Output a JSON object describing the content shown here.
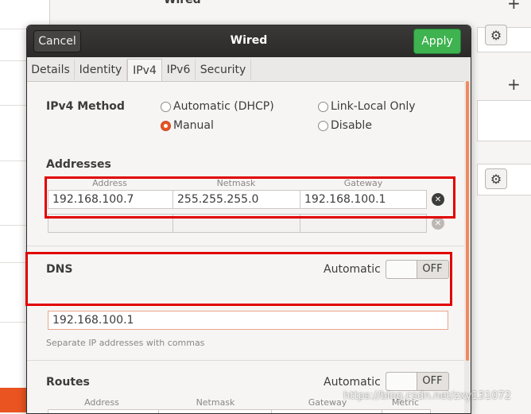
{
  "background": {
    "title": "Wired"
  },
  "dialog": {
    "title": "Wired",
    "cancel_label": "Cancel",
    "apply_label": "Apply",
    "tabs": [
      {
        "label": "Details"
      },
      {
        "label": "Identity"
      },
      {
        "label": "IPv4",
        "active": true
      },
      {
        "label": "IPv6"
      },
      {
        "label": "Security"
      }
    ],
    "ipv4_method": {
      "label": "IPv4 Method",
      "options": [
        {
          "label": "Automatic (DHCP)",
          "selected": false
        },
        {
          "label": "Link-Local Only",
          "selected": false
        },
        {
          "label": "Manual",
          "selected": true
        },
        {
          "label": "Disable",
          "selected": false
        }
      ]
    },
    "addresses": {
      "label": "Addresses",
      "columns": [
        "Address",
        "Netmask",
        "Gateway"
      ],
      "rows": [
        {
          "address": "192.168.100.7",
          "netmask": "255.255.255.0",
          "gateway": "192.168.100.1"
        },
        {
          "address": "",
          "netmask": "",
          "gateway": ""
        }
      ]
    },
    "dns": {
      "label": "DNS",
      "automatic_label": "Automatic",
      "toggle_state": "OFF",
      "value": "192.168.100.1",
      "hint": "Separate IP addresses with commas"
    },
    "routes": {
      "label": "Routes",
      "automatic_label": "Automatic",
      "toggle_state": "OFF",
      "columns": [
        "Address",
        "Netmask",
        "Gateway",
        "Metric"
      ]
    }
  },
  "watermark": "https://blog.csdn.net/zxy131072",
  "colors": {
    "apply": "#3eb34f",
    "accent": "#e95420",
    "highlight": "#e10000"
  }
}
